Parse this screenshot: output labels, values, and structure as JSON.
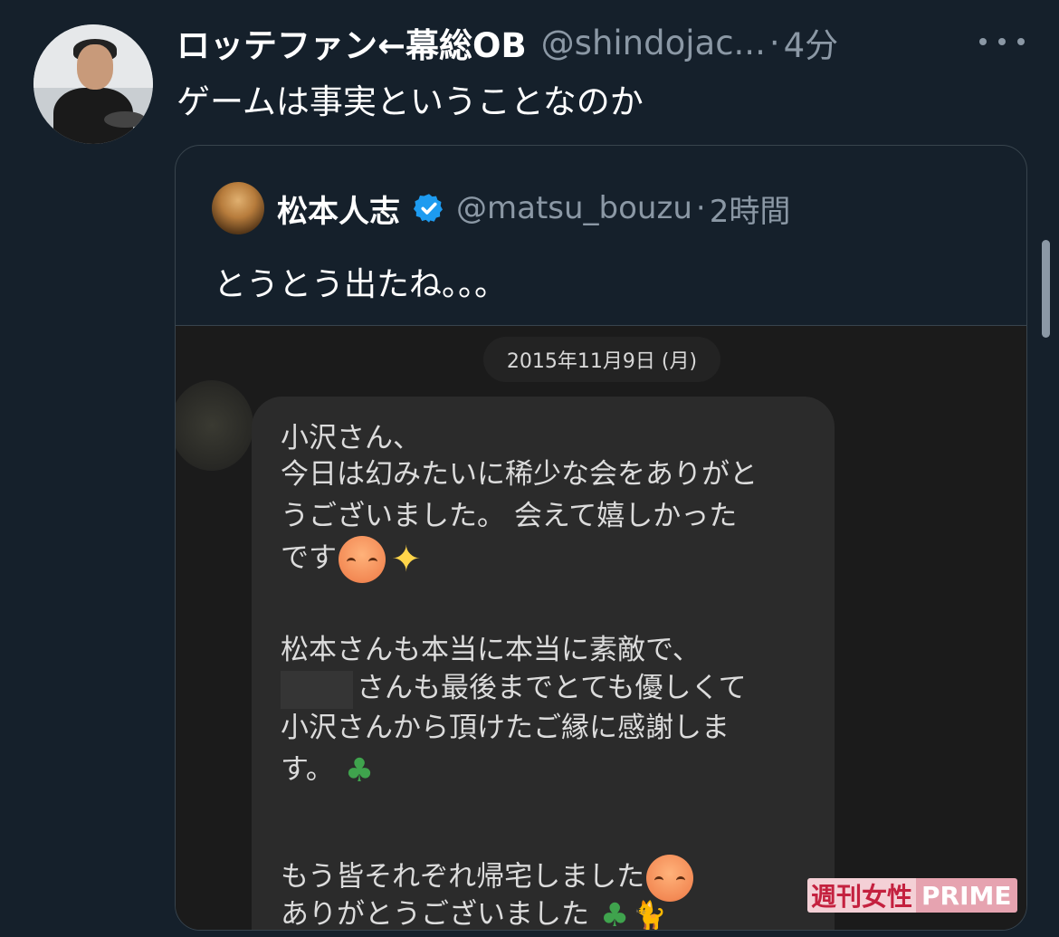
{
  "tweet": {
    "display_name": "ロッテファン←幕総OB",
    "handle": "@shindojac...",
    "separator": "·",
    "time": "4分",
    "text": "ゲームは事実ということなのか"
  },
  "quote": {
    "display_name": "松本人志",
    "handle": "@matsu_bouzu",
    "separator": "·",
    "time": "2時間",
    "text": "とうとう出たね。。。",
    "verified": true,
    "image": {
      "date_label": "2015年11月9日 (月)",
      "lines": [
        "小沢さん、",
        "今日は幻みたいに稀少な会をありがと",
        "うございました。 会えて嬉しかった",
        "です",
        "松本さんも本当に本当に素敵で、",
        "さんも最後までとても優しくて",
        "小沢さんから頂けたご縁に感謝しま",
        "す。",
        "もう皆それぞれ帰宅しました",
        "ありがとうございました"
      ],
      "watermark_a": "週刊女性",
      "watermark_b": "PRIME"
    }
  },
  "icons": {
    "more": "more-horizontal-icon",
    "verified": "verified-badge-icon",
    "emoji_1": "smiling-face-icon",
    "emoji_2": "sparkles-icon",
    "emoji_3": "four-leaf-clover-icon",
    "emoji_4": "cat-icon"
  },
  "colors": {
    "background": "#15202b",
    "secondary_text": "#8b98a5",
    "border": "#38444d",
    "verified_blue": "#1d9bf0"
  }
}
